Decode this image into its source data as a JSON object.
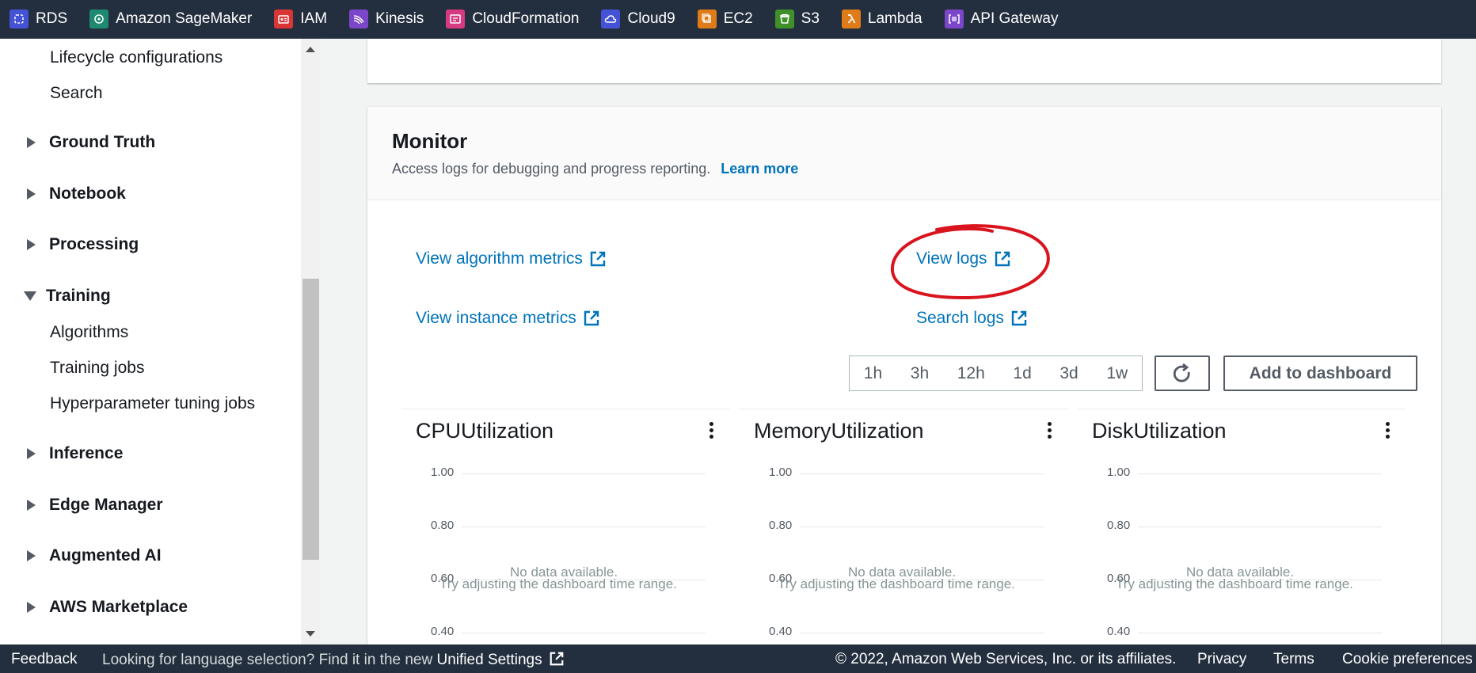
{
  "topbar": {
    "services": [
      {
        "label": "RDS",
        "icon": "rds-icon",
        "color": "#4452d6"
      },
      {
        "label": "Amazon SageMaker",
        "icon": "sagemaker-icon",
        "color": "#1e8a72"
      },
      {
        "label": "IAM",
        "icon": "iam-icon",
        "color": "#d93535"
      },
      {
        "label": "Kinesis",
        "icon": "kinesis-icon",
        "color": "#7b46c9"
      },
      {
        "label": "CloudFormation",
        "icon": "cloudformation-icon",
        "color": "#d63a80"
      },
      {
        "label": "Cloud9",
        "icon": "cloud9-icon",
        "color": "#4452d6"
      },
      {
        "label": "EC2",
        "icon": "ec2-icon",
        "color": "#e07b1a"
      },
      {
        "label": "S3",
        "icon": "s3-icon",
        "color": "#3f8f2a"
      },
      {
        "label": "Lambda",
        "icon": "lambda-icon",
        "color": "#e07b1a"
      },
      {
        "label": "API Gateway",
        "icon": "api-gateway-icon",
        "color": "#7b46c9"
      }
    ]
  },
  "sidebar": {
    "items": [
      {
        "label": "Lifecycle configurations"
      },
      {
        "label": "Search"
      },
      {
        "label": "Ground Truth",
        "state": "collapsed"
      },
      {
        "label": "Notebook",
        "state": "collapsed"
      },
      {
        "label": "Processing",
        "state": "collapsed"
      },
      {
        "label": "Training",
        "state": "expanded"
      },
      {
        "label": "Algorithms"
      },
      {
        "label": "Training jobs"
      },
      {
        "label": "Hyperparameter tuning jobs"
      },
      {
        "label": "Inference",
        "state": "collapsed"
      },
      {
        "label": "Edge Manager",
        "state": "collapsed"
      },
      {
        "label": "Augmented AI",
        "state": "collapsed"
      },
      {
        "label": "AWS Marketplace",
        "state": "collapsed"
      }
    ]
  },
  "monitor": {
    "title": "Monitor",
    "description": "Access logs for debugging and progress reporting.",
    "learn_more": "Learn more",
    "links": {
      "algorithm_metrics": "View algorithm metrics",
      "view_logs": "View logs",
      "instance_metrics": "View instance metrics",
      "search_logs": "Search logs"
    },
    "time_ranges": [
      "1h",
      "3h",
      "12h",
      "1d",
      "3d",
      "1w"
    ],
    "add_to_dashboard": "Add to dashboard",
    "widgets": [
      {
        "title": "CPUUtilization",
        "ticks": [
          "1.00",
          "0.80",
          "0.60",
          "0.40"
        ],
        "no_data": "No data available.",
        "hint": "Try adjusting the dashboard time range."
      },
      {
        "title": "MemoryUtilization",
        "ticks": [
          "1.00",
          "0.80",
          "0.60",
          "0.40"
        ],
        "no_data": "No data available.",
        "hint": "Try adjusting the dashboard time range."
      },
      {
        "title": "DiskUtilization",
        "ticks": [
          "1.00",
          "0.80",
          "0.60",
          "0.40"
        ],
        "no_data": "No data available.",
        "hint": "Try adjusting the dashboard time range."
      }
    ]
  },
  "footer": {
    "feedback": "Feedback",
    "language_prompt": "Looking for language selection? Find it in the new",
    "unified_settings": "Unified Settings",
    "copyright": "© 2022, Amazon Web Services, Inc. or its affiliates.",
    "privacy": "Privacy",
    "terms": "Terms",
    "cookie_preferences": "Cookie preferences"
  },
  "colors": {
    "header_bg": "#232f3e",
    "link": "#0073bb",
    "annotation": "#d9141e"
  }
}
